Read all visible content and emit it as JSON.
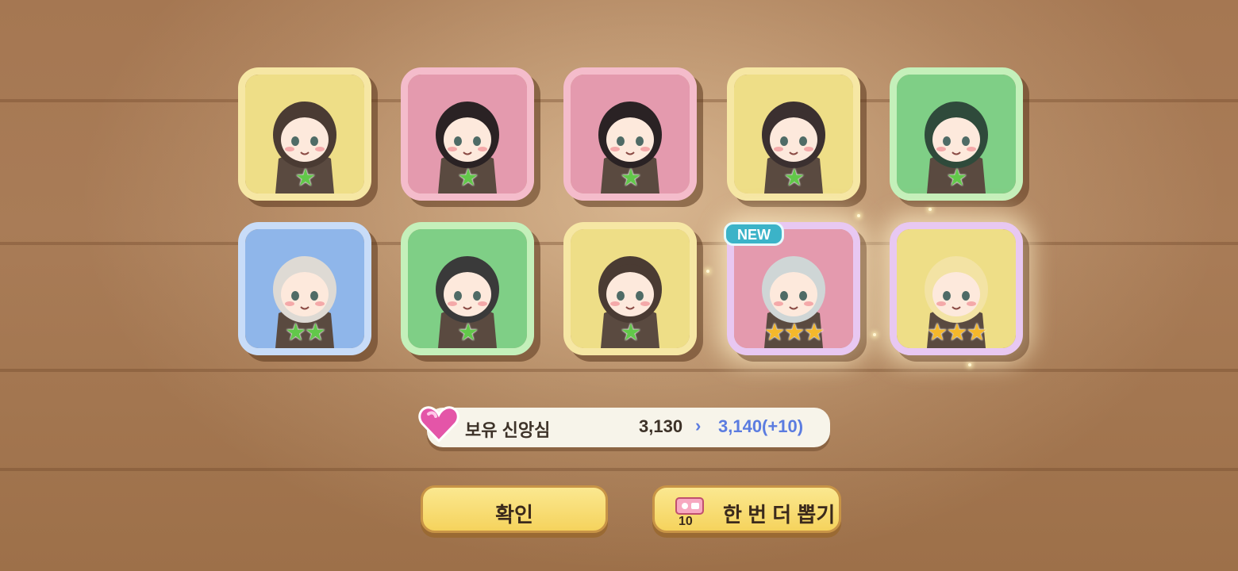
{
  "cards": [
    {
      "id": "card-1",
      "bg": "yellow",
      "hair": "#4a3b33",
      "stars": 1,
      "star_color": "green",
      "new": false
    },
    {
      "id": "card-2",
      "bg": "pink",
      "hair": "#2a2224",
      "stars": 1,
      "star_color": "green",
      "new": false
    },
    {
      "id": "card-3",
      "bg": "pink",
      "hair": "#2a2224",
      "stars": 1,
      "star_color": "green",
      "new": false
    },
    {
      "id": "card-4",
      "bg": "yellow",
      "hair": "#3b3030",
      "stars": 1,
      "star_color": "green",
      "new": false
    },
    {
      "id": "card-5",
      "bg": "green",
      "hair": "#2f4a3b",
      "stars": 1,
      "star_color": "green",
      "new": false
    },
    {
      "id": "card-6",
      "bg": "blue",
      "hair": "#dedad4",
      "stars": 2,
      "star_color": "green",
      "new": false
    },
    {
      "id": "card-7",
      "bg": "green",
      "hair": "#3a3a3a",
      "stars": 1,
      "star_color": "green",
      "new": false
    },
    {
      "id": "card-8",
      "bg": "yellow",
      "hair": "#4a3b33",
      "stars": 1,
      "star_color": "green",
      "new": false
    },
    {
      "id": "card-9",
      "bg": "pink",
      "hair": "#cfd6d6",
      "stars": 3,
      "star_color": "gold",
      "new": true
    },
    {
      "id": "card-10",
      "bg": "yellow",
      "hair": "#f3e3a4",
      "stars": 3,
      "star_color": "gold",
      "new": false
    }
  ],
  "new_badge": "NEW",
  "faith": {
    "label": "보유 신앙심",
    "current": "3,130",
    "arrow": "›",
    "new_value": "3,140(+10)"
  },
  "buttons": {
    "confirm": "확인",
    "again": "한 번 더 뽑기",
    "ticket_count": "10"
  },
  "colors": {
    "accent_blue": "#5b7ce0",
    "button_yellow": "#f5d35d"
  }
}
